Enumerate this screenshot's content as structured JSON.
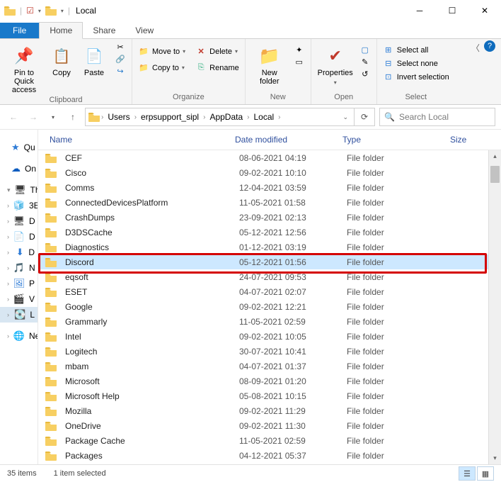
{
  "title": "Local",
  "tabs": {
    "file": "File",
    "home": "Home",
    "share": "Share",
    "view": "View"
  },
  "ribbon": {
    "clipboard": {
      "label": "Clipboard",
      "pin": "Pin to Quick\naccess",
      "copy": "Copy",
      "paste": "Paste"
    },
    "organize": {
      "label": "Organize",
      "move": "Move to",
      "copy": "Copy to",
      "delete": "Delete",
      "rename": "Rename"
    },
    "new": {
      "label": "New",
      "folder": "New\nfolder"
    },
    "open": {
      "label": "Open",
      "properties": "Properties"
    },
    "select": {
      "label": "Select",
      "all": "Select all",
      "none": "Select none",
      "invert": "Invert selection"
    }
  },
  "breadcrumb": [
    "Users",
    "erpsupport_sipl",
    "AppData",
    "Local"
  ],
  "search_placeholder": "Search Local",
  "nav": [
    {
      "icon": "★",
      "color": "#2e7bd6",
      "label": "Qu",
      "chev": ""
    },
    {
      "icon": "☁",
      "color": "#0a5bbf",
      "label": "On",
      "chev": ""
    },
    {
      "icon": "🖥",
      "color": "#3a3a3a",
      "label": "Th",
      "chev": "▾"
    },
    {
      "icon": "🧊",
      "color": "#5aa0d8",
      "label": "3E",
      "chev": "›"
    },
    {
      "icon": "🖥",
      "color": "#3a3a3a",
      "label": "D",
      "chev": "›"
    },
    {
      "icon": "📄",
      "color": "#2e7bd6",
      "label": "D",
      "chev": "›"
    },
    {
      "icon": "⬇",
      "color": "#2e7bd6",
      "label": "D",
      "chev": "›"
    },
    {
      "icon": "🎵",
      "color": "#2e7bd6",
      "label": "N",
      "chev": "›"
    },
    {
      "icon": "🖼",
      "color": "#2e7bd6",
      "label": "P",
      "chev": "›"
    },
    {
      "icon": "🎬",
      "color": "#2e7bd6",
      "label": "V",
      "chev": "›"
    },
    {
      "icon": "💽",
      "color": "#6aa0d0",
      "label": "L",
      "chev": "›",
      "sel": true
    },
    {
      "icon": "🌐",
      "color": "#3a3a3a",
      "label": "Ne",
      "chev": "›"
    }
  ],
  "columns": {
    "name": "Name",
    "date": "Date modified",
    "type": "Type",
    "size": "Size"
  },
  "rows": [
    {
      "name": "CEF",
      "date": "08-06-2021 04:19",
      "type": "File folder"
    },
    {
      "name": "Cisco",
      "date": "09-02-2021 10:10",
      "type": "File folder"
    },
    {
      "name": "Comms",
      "date": "12-04-2021 03:59",
      "type": "File folder"
    },
    {
      "name": "ConnectedDevicesPlatform",
      "date": "11-05-2021 01:58",
      "type": "File folder"
    },
    {
      "name": "CrashDumps",
      "date": "23-09-2021 02:13",
      "type": "File folder"
    },
    {
      "name": "D3DSCache",
      "date": "05-12-2021 12:56",
      "type": "File folder"
    },
    {
      "name": "Diagnostics",
      "date": "01-12-2021 03:19",
      "type": "File folder"
    },
    {
      "name": "Discord",
      "date": "05-12-2021 01:56",
      "type": "File folder",
      "sel": true,
      "highlight": true
    },
    {
      "name": "eqsoft",
      "date": "24-07-2021 09:53",
      "type": "File folder"
    },
    {
      "name": "ESET",
      "date": "04-07-2021 02:07",
      "type": "File folder"
    },
    {
      "name": "Google",
      "date": "09-02-2021 12:21",
      "type": "File folder"
    },
    {
      "name": "Grammarly",
      "date": "11-05-2021 02:59",
      "type": "File folder"
    },
    {
      "name": "Intel",
      "date": "09-02-2021 10:05",
      "type": "File folder"
    },
    {
      "name": "Logitech",
      "date": "30-07-2021 10:41",
      "type": "File folder"
    },
    {
      "name": "mbam",
      "date": "04-07-2021 01:37",
      "type": "File folder"
    },
    {
      "name": "Microsoft",
      "date": "08-09-2021 01:20",
      "type": "File folder"
    },
    {
      "name": "Microsoft Help",
      "date": "05-08-2021 10:15",
      "type": "File folder"
    },
    {
      "name": "Mozilla",
      "date": "09-02-2021 11:29",
      "type": "File folder"
    },
    {
      "name": "OneDrive",
      "date": "09-02-2021 11:30",
      "type": "File folder"
    },
    {
      "name": "Package Cache",
      "date": "11-05-2021 02:59",
      "type": "File folder"
    },
    {
      "name": "Packages",
      "date": "04-12-2021 05:37",
      "type": "File folder"
    }
  ],
  "status": {
    "count": "35 items",
    "selected": "1 item selected"
  }
}
